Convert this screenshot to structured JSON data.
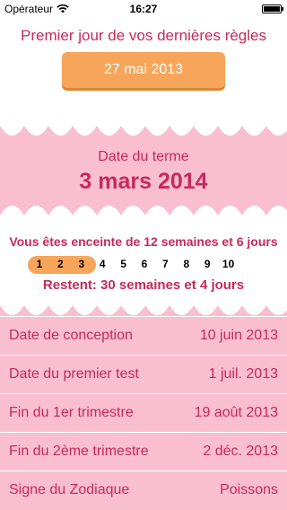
{
  "status_bar": {
    "carrier": "Opérateur",
    "time": "16:27"
  },
  "header": {
    "title": "Premier jour de vos dernières règles",
    "last_period_date": "27 mai 2013"
  },
  "due": {
    "label": "Date du terme",
    "date": "3 mars 2014"
  },
  "progress": {
    "pregnant_text": "Vous êtes enceinte de 12 semaines et 6 jours",
    "months": [
      "1",
      "2",
      "3",
      "4",
      "5",
      "6",
      "7",
      "8",
      "9",
      "10"
    ],
    "months_highlighted": 3,
    "remaining_text": "Restent: 30 semaines et 4 jours"
  },
  "details": [
    {
      "label": "Date de conception",
      "value": "10 juin 2013"
    },
    {
      "label": "Date du premier test",
      "value": "1 juil. 2013"
    },
    {
      "label": "Fin du 1er trimestre",
      "value": "19 août 2013"
    },
    {
      "label": "Fin du 2ème trimestre",
      "value": "2 déc. 2013"
    },
    {
      "label": "Signe du Zodiaque",
      "value": "Poissons"
    }
  ],
  "colors": {
    "accent_pink": "#c7295a",
    "band_pink": "#f9bfd0",
    "button_orange": "#f7a55a"
  }
}
